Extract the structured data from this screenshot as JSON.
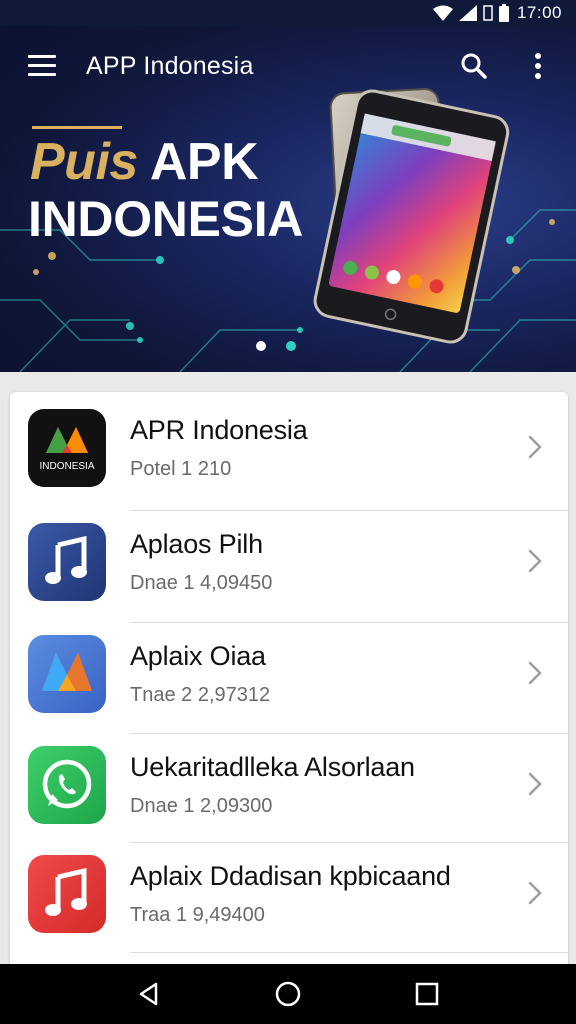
{
  "status_bar": {
    "time": "17:00",
    "icons": [
      "wifi-icon",
      "signal-icon",
      "data-icon",
      "battery-icon"
    ]
  },
  "app_bar": {
    "title": "APP Indonesia",
    "icons": [
      "menu-icon",
      "search-icon",
      "more-vert-icon"
    ]
  },
  "banner": {
    "line1_gold": "Puis",
    "line1_white": " APK",
    "line2": "INDONESIA",
    "dots": {
      "active_index": 0,
      "count": 2
    },
    "colors": {
      "gold": "#d9b160",
      "background": "#141d4a",
      "accent": "#2fd1c3"
    }
  },
  "list": {
    "items": [
      {
        "title": "APR Indonesia",
        "subtitle": "Potel 1 210",
        "icon": "indonesia-logo-icon",
        "icon_text": "INDONESIA"
      },
      {
        "title": "Aplaos Pilh",
        "subtitle": "Dnae 1 4,09450",
        "icon": "music-note-icon"
      },
      {
        "title": "Aplaix Oiaa",
        "subtitle": "Tnae 2 2,97312",
        "icon": "m-logo-icon"
      },
      {
        "title": "Uekaritadlleka Alsorlaan",
        "subtitle": "Dnae 1 2,09300",
        "icon": "whatsapp-icon"
      },
      {
        "title": "Aplaix Ddadisan kpbicaand",
        "subtitle": "Traa 1 9,49400",
        "icon": "music-note-red-icon"
      }
    ]
  },
  "nav_bar": {
    "buttons": [
      "back-icon",
      "home-icon",
      "recents-icon"
    ]
  }
}
